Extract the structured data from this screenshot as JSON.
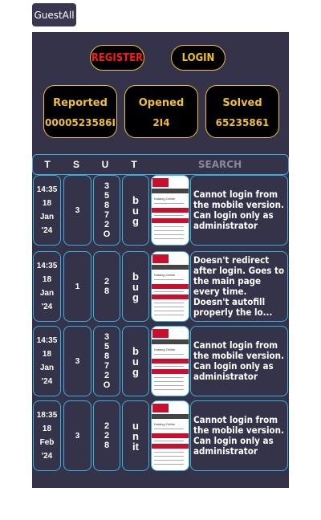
{
  "top_button": "GuestAll",
  "auth": {
    "register": "REGISTER",
    "login": "LOGIN"
  },
  "stats": [
    {
      "label": "Reported",
      "value": "0000523586I"
    },
    {
      "label": "Opened",
      "value": "2I4"
    },
    {
      "label": "Solved",
      "value": "65235861"
    }
  ],
  "columns": [
    "T",
    "S",
    "U",
    "T"
  ],
  "search_placeholder": "SEARCH",
  "thumbnail_text": "Katalog Online",
  "rows": [
    {
      "date": [
        "14:35",
        "18",
        "Jan",
        "'24"
      ],
      "s": "3",
      "u": "35872O",
      "t": "bug",
      "desc": "Cannot login from the mobile version. Can login only as administrator"
    },
    {
      "date": [
        "14:35",
        "18",
        "Jan",
        "'24"
      ],
      "s": "1",
      "u": "28",
      "t": "bug",
      "desc": "Doesn't redirect after login. Goes to the main page every time. Doesn't autofill properly the lo..."
    },
    {
      "date": [
        "14:35",
        "18",
        "Jan",
        "'24"
      ],
      "s": "3",
      "u": "35872O",
      "t": "bug",
      "desc": "Cannot login from the mobile version. Can login only as administrator"
    },
    {
      "date": [
        "18:35",
        "18",
        "Feb",
        "'24"
      ],
      "s": "3",
      "u": "228",
      "t": "unit",
      "desc": "Cannot login from the mobile version. Can login only as administrator"
    }
  ]
}
